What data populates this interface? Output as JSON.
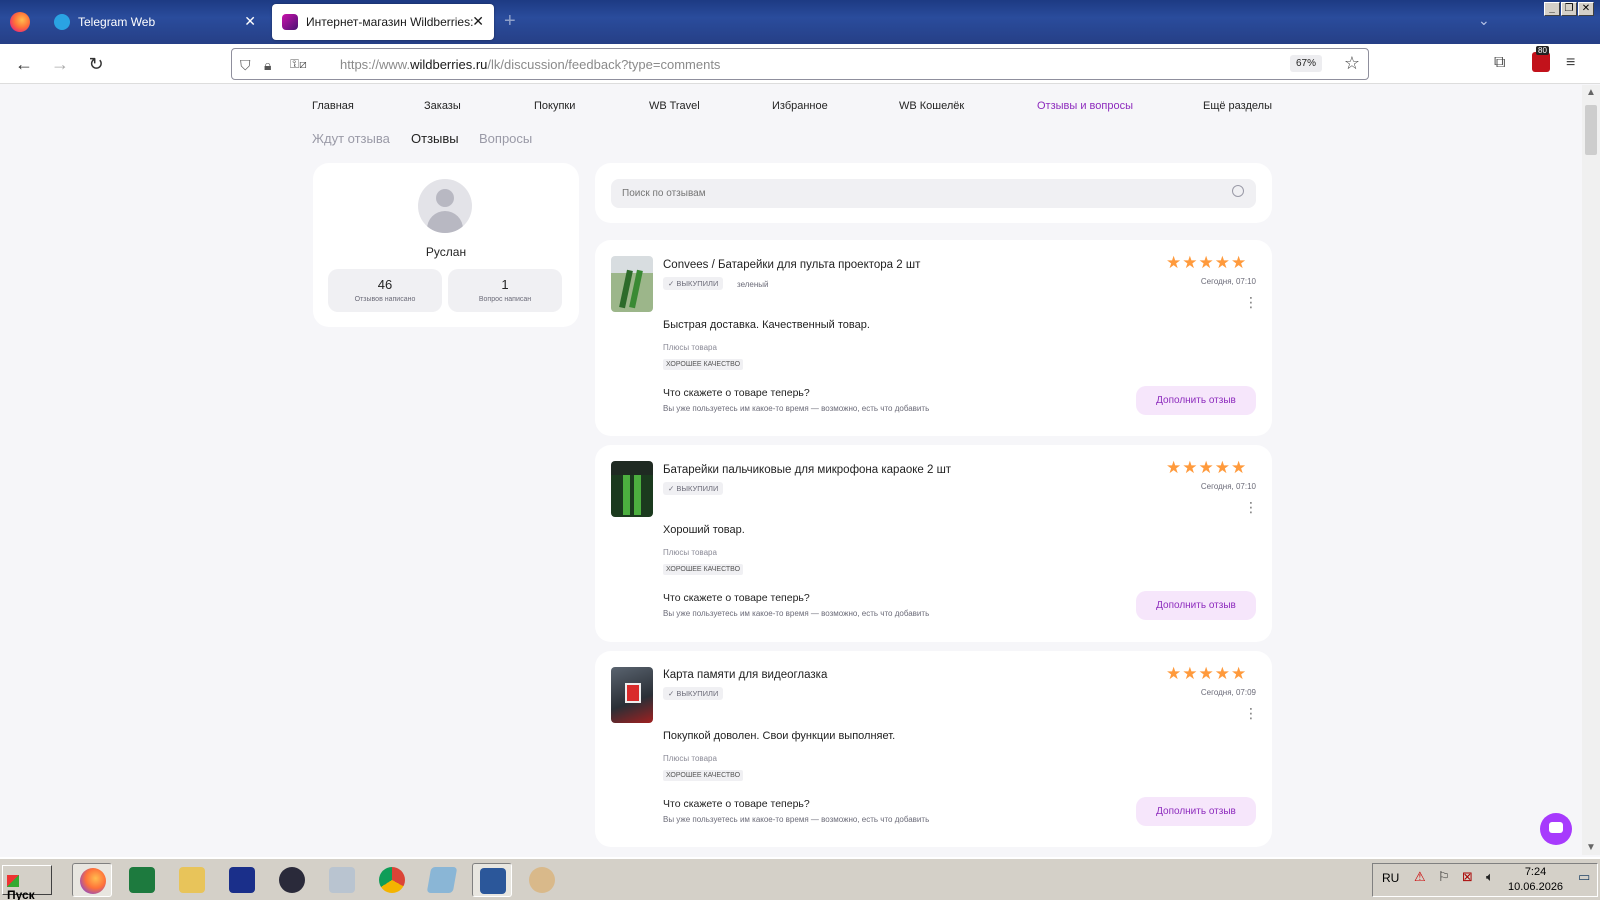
{
  "browser": {
    "tabs": [
      {
        "title": "Telegram Web",
        "active": false
      },
      {
        "title": "Интернет-магазин Wildberries: ш",
        "active": true
      }
    ],
    "url_prefix": "https://www.",
    "url_domain": "wildberries.ru",
    "url_path": "/lk/discussion/feedback?type=comments",
    "zoom": "67%",
    "extension_badge": "80",
    "colors": {
      "tabbar": "#263f86",
      "accent": "#8d2bbd",
      "star": "#ff9a3c"
    }
  },
  "site": {
    "topnav": [
      "Главная",
      "Заказы",
      "Покупки",
      "WB Travel",
      "Избранное",
      "WB Кошелёк",
      "Отзывы и вопросы",
      "Ещё разделы"
    ],
    "topnav_active": "Отзывы и вопросы",
    "subtabs": [
      "Ждут отзыва",
      "Отзывы",
      "Вопросы"
    ],
    "subtab_active": "Отзывы",
    "profile": {
      "name": "Руслан",
      "stats": [
        {
          "value": "46",
          "label": "Отзывов написано"
        },
        {
          "value": "1",
          "label": "Вопрос написан"
        }
      ]
    },
    "search_placeholder": "Поиск по отзывам",
    "reviews": [
      {
        "title": "Convees / Батарейки для пульта проектора 2 шт",
        "badge": "ВЫКУПИЛИ",
        "color": "зеленый",
        "rating": 5,
        "stars": "★★★★★",
        "date": "Сегодня, 07:10",
        "text": "Быстрая доставка. Качественный товар.",
        "plus_label": "Плюсы товара",
        "plus_tag": "ХОРОШЕЕ КАЧЕСТВО",
        "question": "Что скажете о товаре теперь?",
        "question_sub": "Вы уже пользуетесь им какое-то время — возможно, есть что добавить",
        "button": "Дополнить отзыв"
      },
      {
        "title": "Батарейки пальчиковые для микрофона караоке 2 шт",
        "badge": "ВЫКУПИЛИ",
        "color": "",
        "rating": 5,
        "stars": "★★★★★",
        "date": "Сегодня, 07:10",
        "text": "Хороший товар.",
        "plus_label": "Плюсы товара",
        "plus_tag": "ХОРОШЕЕ КАЧЕСТВО",
        "question": "Что скажете о товаре теперь?",
        "question_sub": "Вы уже пользуетесь им какое-то время — возможно, есть что добавить",
        "button": "Дополнить отзыв"
      },
      {
        "title": "Карта памяти для видеоглазка",
        "badge": "ВЫКУПИЛИ",
        "color": "",
        "rating": 5,
        "stars": "★★★★★",
        "date": "Сегодня, 07:09",
        "text": "Покупкой доволен. Свои функции выполняет.",
        "plus_label": "Плюсы товара",
        "plus_tag": "ХОРОШЕЕ КАЧЕСТВО",
        "question": "Что скажете о товаре теперь?",
        "question_sub": "Вы уже пользуетесь им какое-то время — возможно, есть что добавить",
        "button": "Дополнить отзыв"
      }
    ]
  },
  "taskbar": {
    "start": "Пуск",
    "apps": [
      "firefox-icon",
      "excel-icon",
      "folder-icon",
      "floppy-save-icon",
      "lock-icon",
      "calculator-icon",
      "chrome-icon",
      "notepad-icon",
      "word-icon",
      "paint-icon"
    ],
    "lang": "RU",
    "time": "7:24",
    "date": "10.06.2026"
  }
}
